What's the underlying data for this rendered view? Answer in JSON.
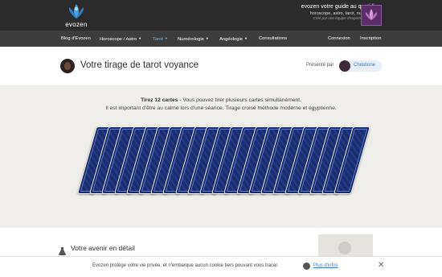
{
  "brand": {
    "logo_text": "evozen",
    "tagline_brand": "evozen",
    "tagline": "votre guide au quotidien",
    "tagline_topics": "horoscope, astro, tarot, numérologie",
    "tagline_credit": "Créé par une équipe d'experts passionnés"
  },
  "nav": {
    "items": [
      {
        "label": "Blog d'Evozen",
        "dropdown": false,
        "active": false
      },
      {
        "label": "Horoscope / Astro",
        "dropdown": true,
        "active": false
      },
      {
        "label": "Tarot",
        "dropdown": true,
        "active": true
      },
      {
        "label": "Numérologie",
        "dropdown": true,
        "active": false
      },
      {
        "label": "Angéologie",
        "dropdown": true,
        "active": false
      },
      {
        "label": "Consultations",
        "dropdown": false,
        "active": false
      }
    ],
    "login": "Connexion",
    "signup": "Inscription"
  },
  "page": {
    "title": "Votre tirage de tarot voyance",
    "presented_by": "Présenté par",
    "author": "Christione"
  },
  "intro": {
    "bold": "Tirez 12 cartes",
    "line1_rest": " - Vous pouvez tirer plusieurs cartes simultanément.",
    "line2": "Il est important d'être au calme lors d'une séance. Tirage croisé méthode moderne et égyptienne."
  },
  "cards": {
    "count": 22
  },
  "section": {
    "title": "Votre avenir en détail"
  },
  "cookie": {
    "text": "Evozen protège votre vie privée, et n'embarque aucun cookie tiers pouvant vous tracer.",
    "link": "Plus d'infos",
    "close": "✕"
  },
  "colors": {
    "topbar": "#2b2b2b",
    "nav": "#3d3d3d",
    "accent": "#3a7bbf",
    "card_back": "#1c2d6e"
  }
}
